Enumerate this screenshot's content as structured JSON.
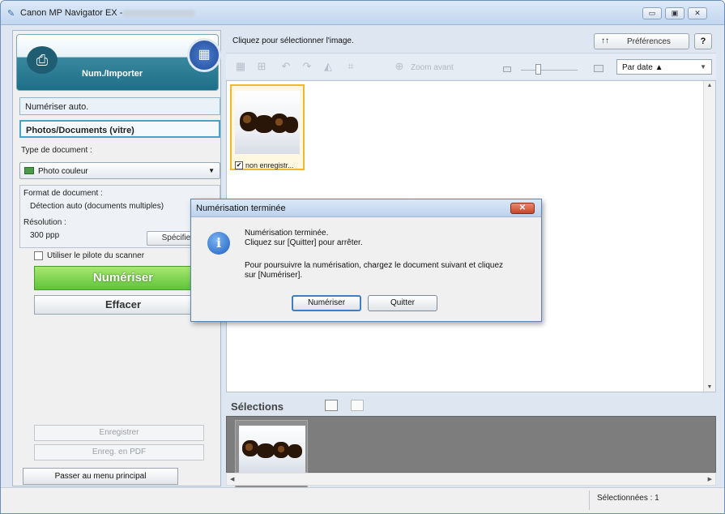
{
  "window": {
    "title": "Canon MP Navigator EX -",
    "controls": {
      "minimize": "▭",
      "maximize": "▣",
      "close": "✕"
    }
  },
  "left": {
    "header_title": "Num./Importer",
    "mode_auto": "Numériser auto.",
    "mode_photo": "Photos/Documents (vitre)",
    "doc_type_label": "Type de document :",
    "doc_type_value": "Photo couleur",
    "format_label": "Format de document :",
    "format_value": "Détection auto (documents multiples)",
    "resolution_label": "Résolution :",
    "resolution_value": "300 ppp",
    "specify_button": "Spécifier...",
    "use_driver_label": "Utiliser le pilote du scanner",
    "scan_button": "Numériser",
    "clear_button": "Effacer",
    "save_button": "Enregistrer",
    "save_pdf_button": "Enreg. en PDF",
    "back_button": "Passer au menu principal"
  },
  "right": {
    "instruction": "Cliquez pour sélectionner l'image.",
    "preferences_button": "Préférences",
    "help_button": "?",
    "zoom_label": "Zoom avant",
    "sort_value": "Par date ▲",
    "thumb_label": "non enregistr...",
    "selections_title": "Sélections"
  },
  "status": {
    "selected": "Sélectionnées : 1"
  },
  "dialog": {
    "title": "Numérisation terminée",
    "line1": "Numérisation terminée.",
    "line2": "Cliquez sur [Quitter] pour arrêter.",
    "line3": "Pour poursuivre la numérisation, chargez le document suivant et cliquez",
    "line4": "sur [Numériser].",
    "scan_button": "Numériser",
    "quit_button": "Quitter",
    "close_glyph": "✕"
  }
}
